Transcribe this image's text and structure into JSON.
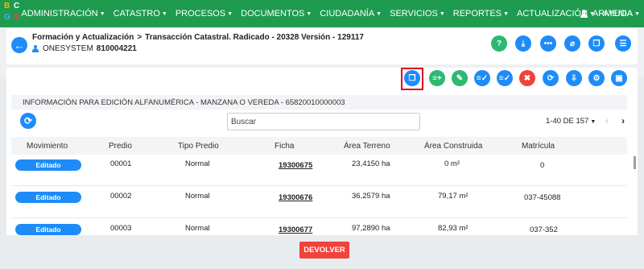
{
  "logo": {
    "letters": [
      "B",
      "C",
      "G",
      "S"
    ]
  },
  "nav": {
    "items": [
      {
        "label": "ADMINISTRACIÓN"
      },
      {
        "label": "CATASTRO"
      },
      {
        "label": "PROCESOS"
      },
      {
        "label": "DOCUMENTOS"
      },
      {
        "label": "CIUDADANÍA"
      },
      {
        "label": "SERVICIOS"
      },
      {
        "label": "REPORTES"
      },
      {
        "label": "ACTUALIZACIÓN"
      },
      {
        "label": "AYUDA"
      }
    ],
    "user": "ARMENIA"
  },
  "header": {
    "breadcrumb_1": "Formación y Actualización",
    "breadcrumb_sep": ">",
    "breadcrumb_2": "Transacción Catastral. Radicado - 20328 Versión - 129117",
    "user_name": "ONESYSTEM",
    "user_code": "810004221",
    "icons": [
      "help-icon",
      "download-icon",
      "more-icon",
      "attachment-icon",
      "copy-icon",
      "chat-icon"
    ]
  },
  "toolbar": {
    "icons": [
      {
        "name": "duplicate-icon",
        "color": "#1d8cf8",
        "highlighted": true
      },
      {
        "name": "list-add-icon",
        "color": "#2eb872"
      },
      {
        "name": "edit-document-icon",
        "color": "#2eb872"
      },
      {
        "name": "list-check-icon",
        "color": "#1d8cf8"
      },
      {
        "name": "list-edit-icon",
        "color": "#1d8cf8"
      },
      {
        "name": "delete-document-icon",
        "color": "#f0433a"
      },
      {
        "name": "sync-icon",
        "color": "#1d8cf8"
      },
      {
        "name": "import-icon",
        "color": "#1d8cf8"
      },
      {
        "name": "document-settings-icon",
        "color": "#1d8cf8"
      },
      {
        "name": "save-icon",
        "color": "#1d8cf8"
      }
    ]
  },
  "main": {
    "info_title": "INFORMACIÓN PARA EDICIÓN ALFANUMÉRICA - MANZANA O VEREDA - 65820010000003",
    "search_placeholder": "Buscar",
    "pager": "1-40 DE 157",
    "columns": [
      "Movimiento",
      "Predio",
      "Tipo Predio",
      "Ficha",
      "Área Terreno",
      "Área Construida",
      "Matrícula"
    ],
    "rows": [
      {
        "movimiento": "Editado",
        "predio": "00001",
        "tipo": "Normal",
        "ficha": "19300675",
        "area_terreno": "23,4150 ha",
        "area_construida": "0 m²",
        "matricula": "0"
      },
      {
        "movimiento": "Editado",
        "predio": "00002",
        "tipo": "Normal",
        "ficha": "19300676",
        "area_terreno": "36,2579 ha",
        "area_construida": "79,17 m²",
        "matricula": "037-45088"
      },
      {
        "movimiento": "Editado",
        "predio": "00003",
        "tipo": "Normal",
        "ficha": "19300677",
        "area_terreno": "97,2890 ha",
        "area_construida": "82,93 m²",
        "matricula": "037-352"
      }
    ],
    "action_button": "DEVOLVER"
  },
  "colors": {
    "nav_green": "#1e9b4f",
    "accent_blue": "#1d8cf8",
    "action_green": "#2eb872",
    "danger_red": "#f0433a",
    "highlight_red": "#e2001a"
  }
}
